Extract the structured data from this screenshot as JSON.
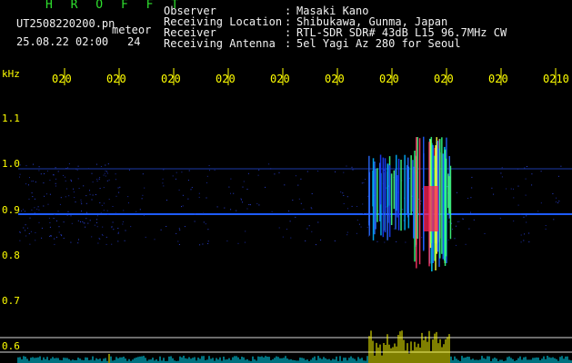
{
  "app": {
    "title": "H R O F F T",
    "filename": "UT2508220200.pn",
    "mode": "meteor",
    "datetime": "25.08.22 02:00",
    "count": "24"
  },
  "info": [
    {
      "label": "Observer",
      "value": "Masaki Kano"
    },
    {
      "label": "Receiving Location",
      "value": "Shibukawa, Gunma, Japan"
    },
    {
      "label": "Receiver",
      "value": "RTL-SDR SDR# 43dB L15 96.7MHz CW"
    },
    {
      "label": "Receiving Antenna",
      "value": "5el Yagi Az 280 for Seoul"
    }
  ],
  "chart_data": {
    "type": "heatmap",
    "ylabel": "kHz",
    "y_ticks": [
      "1.1",
      "1.0",
      "0.9",
      "0.8",
      "0.7",
      "0.6"
    ],
    "x_ticks": [
      "020",
      "020",
      "020",
      "020",
      "020",
      "020",
      "020",
      "020",
      "020",
      "0210"
    ],
    "grid": true,
    "colors": {
      "axis_text": "#ffff00",
      "grid": "#d8d8d8",
      "baseline": "#1e5cff",
      "echo_peak": "#ff2255",
      "spectrum_meteor": "#ffff00",
      "spectrum_noise": "#00e5ff"
    }
  }
}
